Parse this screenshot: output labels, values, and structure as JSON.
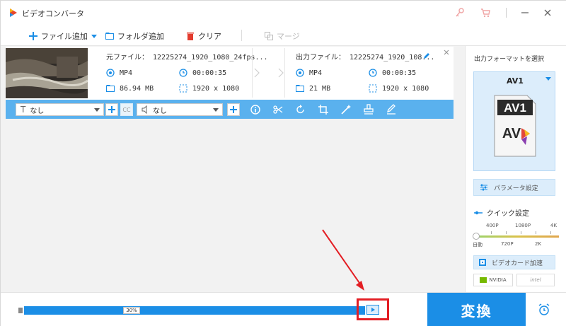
{
  "window": {
    "title": "ビデオコンバータ"
  },
  "toolbar": {
    "add_file": "ファイル追加",
    "add_folder": "フォルダ追加",
    "clear": "クリア",
    "merge": "マージ"
  },
  "file": {
    "source_name": "元ファイル： 12225274_1920_1080_24fps...",
    "output_name": "出力ファイル： 12225274_1920_108...",
    "source": {
      "format": "MP4",
      "duration": "00:00:35",
      "size": "86.94 MB",
      "resolution": "1920 x 1080"
    },
    "output": {
      "format": "MP4",
      "duration": "00:00:35",
      "size": "21 MB",
      "resolution": "1920 x 1080"
    }
  },
  "editbar": {
    "subtitle_value": "なし",
    "audio_value": "なし",
    "cc_label": "CC"
  },
  "right_panel": {
    "title": "出力フォーマットを選択",
    "format_name": "AV1",
    "format_icon_top": "AV1",
    "format_icon_bottom": "AV",
    "param_settings": "パラメータ設定",
    "quick_settings": "クイック設定",
    "quality_top": [
      "400P",
      "1080P",
      "4K"
    ],
    "quality_bottom": [
      "自動",
      "720P",
      "2K"
    ],
    "gpu_accel": "ビデオカード加速",
    "vendor_nvidia": "NVIDIA",
    "vendor_intel": "intel"
  },
  "bottom": {
    "progress_percent": 30,
    "progress_text": "30%",
    "convert_label": "変換"
  },
  "colors": {
    "accent": "#1b8ee6",
    "editbar": "#5ab1ee",
    "highlight": "#e31e24"
  }
}
